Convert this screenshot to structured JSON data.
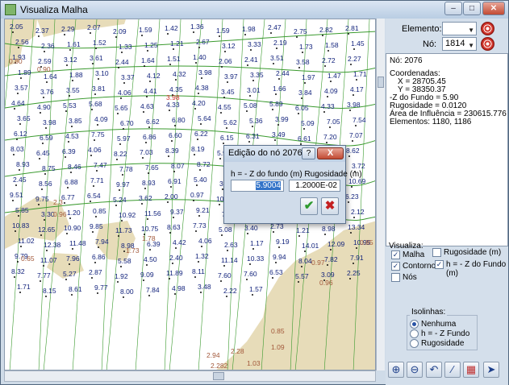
{
  "window": {
    "title": "Visualiza Malha",
    "min_label": "–",
    "max_label": "□",
    "close_label": "✕"
  },
  "panel": {
    "elemento_label": "Elemento:",
    "elemento_value": "",
    "no_label": "Nó:",
    "no_value": "1814",
    "info": {
      "node_line": "Nó: 2076",
      "coord_header": "Coordenadas:",
      "x_line": "X = 28705.45",
      "y_line": "Y = 38350.37",
      "z_line": "-Z do Fundo = 5.90",
      "rug_line": "Rugosidade = 0.0120",
      "area_line": "Área de Influência = 230615.776",
      "elem_line": "Elementos: 1180, 1186"
    },
    "visualiza": {
      "header": "Visualiza:",
      "malha": {
        "label": "Malha",
        "checked": true
      },
      "contornos": {
        "label": "Contornos",
        "checked": true
      },
      "nos": {
        "label": "Nós",
        "checked": false
      },
      "rugosidade": {
        "label": "Rugosidade (m)",
        "checked": false
      },
      "h_z": {
        "label": "h = - Z do Fundo (m)",
        "checked": true
      }
    },
    "isolinhas": {
      "header": "Isolinhas:",
      "options": [
        "Nenhuma",
        "h = - Z Fundo",
        "Rugosidade"
      ],
      "selected": "Nenhuma"
    },
    "toolbar_icons": [
      "zoom-in-icon",
      "zoom-out-icon",
      "undo-zoom-icon",
      "draw-line-icon",
      "grid-icon",
      "export-icon"
    ]
  },
  "dialog": {
    "title": "Edição do nó 2076",
    "help_label": "?",
    "close_label": "X",
    "fields_label": "h = - Z do fundo (m)  Rugosidade (m)",
    "depth_value": "5.9004",
    "rugosity_value": "1.2000E-02",
    "ok_glyph": "✔",
    "cancel_glyph": "✖"
  },
  "map": {
    "depth_labels": [
      "2.05",
      "2.37",
      "2.29",
      "2.07",
      "2.09",
      "1.59",
      "1.42",
      "1.36",
      "1.59",
      "1.98",
      "2.47",
      "2.75",
      "2.82",
      "2.81",
      "2.56",
      "2.36",
      "1.61",
      "1.52",
      "1.33",
      "1.25",
      "1.21",
      "2.67",
      "3.12",
      "3.33",
      "2.19",
      "1.73",
      "1.58",
      "1.45",
      "1.93",
      "2.59",
      "3.12",
      "3.61",
      "2.44",
      "1.64",
      "1.51",
      "1.40",
      "2.06",
      "2.41",
      "3.51",
      "3.58",
      "2.72",
      "2.27",
      "1.89",
      "1.64",
      "1.88",
      "3.10",
      "3.37",
      "4.12",
      "4.32",
      "3.98",
      "3.97",
      "3.35",
      "2.44",
      "1.97",
      "1.47",
      "1.71",
      "3.57",
      "3.76",
      "3.55",
      "3.81",
      "4.06",
      "4.41",
      "4.35",
      "4.38",
      "3.45",
      "3.01",
      "1.66",
      "3.84",
      "4.09",
      "4.17",
      "4.64",
      "4.90",
      "5.53",
      "5.68",
      "5.65",
      "4.63",
      "4.33",
      "4.20",
      "4.55",
      "5.08",
      "5.89",
      "6.05",
      "4.33",
      "3.98",
      "3.65",
      "3.98",
      "3.85",
      "4.09",
      "6.70",
      "6.62",
      "6.80",
      "5.64",
      "5.62",
      "5.36",
      "3.99",
      "5.09",
      "7.05",
      "7.54",
      "6.12",
      "6.59",
      "4.53",
      "7.75",
      "5.97",
      "6.86",
      "6.60",
      "6.22",
      "6.15",
      "6.31",
      "3.49",
      "6.61",
      "7.20",
      "7.07",
      "8.03",
      "6.45",
      "6.39",
      "4.06",
      "8.22",
      "7.03",
      "8.39",
      "8.19",
      "5.92",
      "5.66",
      "7.00",
      "7.95",
      "8.14",
      "8.62",
      "8.93",
      "8.75",
      "8.46",
      "7.47",
      "7.78",
      "7.65",
      "8.07",
      "8.72",
      "7.59",
      "6.36",
      "6.04",
      "5.61",
      "4.94",
      "3.72",
      "2.45",
      "8.56",
      "6.88",
      "7.71",
      "9.97",
      "8.93",
      "6.91",
      "5.40",
      "3.79",
      "2.06",
      "1.31",
      "0.88",
      "10.51",
      "10.69",
      "9.51",
      "9.75",
      "6.77",
      "6.54",
      "5.24",
      "3.62",
      "2.00",
      "0.97",
      "10.84",
      "10.98",
      "9.79",
      "10.38",
      "10.41",
      "6.23",
      "5.85",
      "3.30",
      "1.20",
      "0.85",
      "10.92",
      "11.56",
      "9.37",
      "9.21",
      "7.46",
      "6.81",
      "6.00",
      "4.91",
      "3.21",
      "2.12",
      "10.83",
      "12.65",
      "10.90",
      "9.85",
      "11.73",
      "10.75",
      "8.63",
      "7.73",
      "5.08",
      "3.40",
      "2.73",
      "1.21",
      "8.98",
      "13.34",
      "11.02",
      "12.38",
      "11.48",
      "7.94",
      "8.98",
      "6.39",
      "4.42",
      "4.06",
      "2.63",
      "1.17",
      "9.19",
      "14.01",
      "12.09",
      "10.95",
      "9.79",
      "11.07",
      "7.96",
      "6.86",
      "5.58",
      "4.50",
      "2.40",
      "1.32",
      "11.14",
      "10.33",
      "9.94",
      "8.04",
      "7.82",
      "7.91",
      "8.32",
      "7.77",
      "5.27",
      "2.87",
      "1.92",
      "9.09",
      "11.89",
      "8.11",
      "7.60",
      "7.60",
      "6.53",
      "5.57",
      "3.09",
      "2.25",
      "1.71",
      "8.15",
      "8.61",
      "9.77",
      "8.00",
      "7.84",
      "4.98",
      "3.48",
      "2.22",
      "1.57"
    ],
    "coast_labels": [
      "0.80",
      "0.90",
      "0.96",
      "0.85",
      "1.03",
      "0.65",
      "0.85",
      "0.97",
      "2.3",
      "1.78",
      "1.73",
      "2.94",
      "2.28",
      "2.282",
      "0.96",
      "1.09"
    ]
  },
  "colors": {
    "land": "#e7dcb9",
    "mesh_green": "#3a9a2e",
    "label_blue": "#0e1f7a",
    "label_coast": "#a2583a",
    "highlight_red": "#d0302a"
  }
}
